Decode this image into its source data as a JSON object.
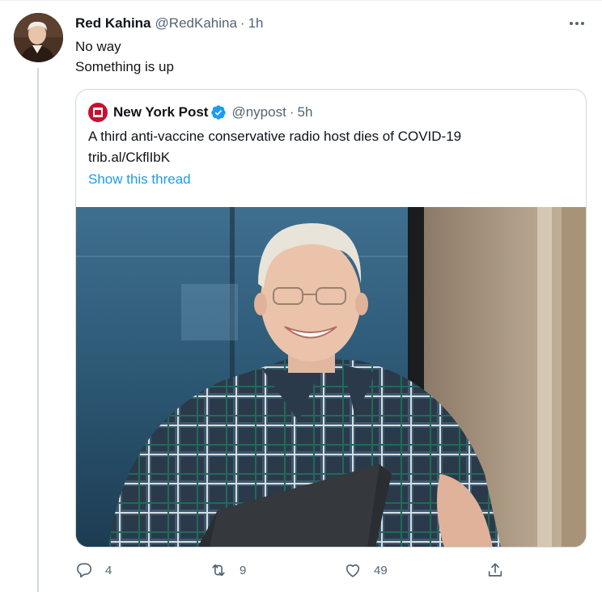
{
  "tweet": {
    "display_name": "Red Kahina",
    "handle": "@RedKahina",
    "separator": "·",
    "time": "1h",
    "text_lines": [
      "No way",
      "Something is up"
    ],
    "avatar_icon": "portrait-avatar"
  },
  "quote": {
    "display_name": "New York Post",
    "verified": true,
    "handle": "@nypost",
    "separator": "·",
    "time": "5h",
    "text_line1": "A third anti-vaccine conservative radio host dies of COVID-19",
    "text_line2": "trib.al/CkflIbK",
    "show_thread": "Show this thread",
    "avatar_icon": "new-york-post-logo",
    "media_icon": "photo-man-with-laptop"
  },
  "actions": {
    "reply": {
      "icon": "reply-icon",
      "count": "4"
    },
    "retweet": {
      "icon": "retweet-icon",
      "count": "9"
    },
    "like": {
      "icon": "heart-icon",
      "count": "49"
    },
    "share": {
      "icon": "share-icon"
    }
  },
  "colors": {
    "link": "#1d9bf0",
    "secondary_text": "#536471",
    "border": "#cfd9de",
    "verified": "#1d9bf0"
  }
}
